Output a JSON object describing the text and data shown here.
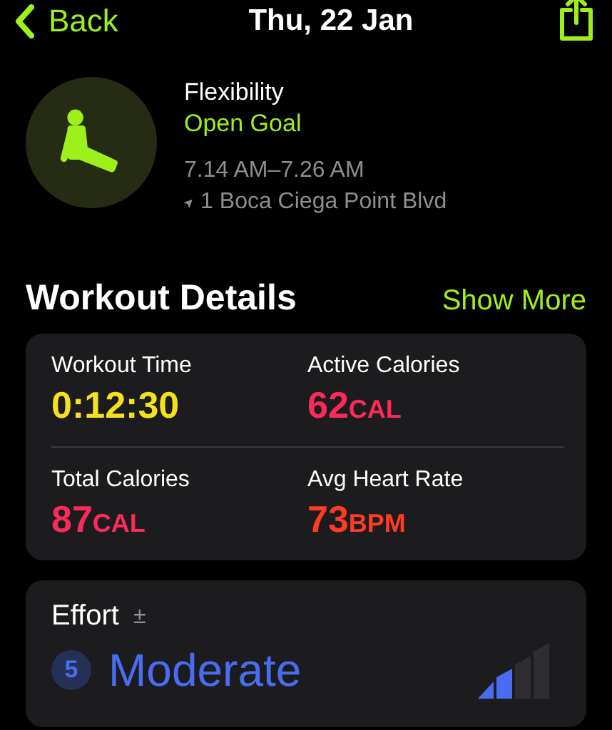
{
  "nav": {
    "back": "Back",
    "title": "Thu, 22 Jan"
  },
  "workout": {
    "name": "Flexibility",
    "goal": "Open Goal",
    "time_range": "7.14 AM–7.26 AM",
    "location_arrow": "➤",
    "location": "1 Boca Ciega Point Blvd"
  },
  "section": {
    "title": "Workout Details",
    "action": "Show More"
  },
  "metrics": [
    {
      "label": "Workout Time",
      "value": "0:12:30",
      "color": "#f4e21c"
    },
    {
      "label": "Active Calories",
      "value": "62",
      "unit": "CAL",
      "color": "#fa2a5a"
    },
    {
      "label": "Total Calories",
      "value": "87",
      "unit": "CAL",
      "color": "#fa2a5a"
    },
    {
      "label": "Avg Heart Rate",
      "value": "73",
      "unit": "BPM",
      "color": "#ff3b22"
    }
  ],
  "effort": {
    "title": "Effort",
    "adjust": "±",
    "score": "5",
    "rating": "Moderate",
    "level": 0.5
  }
}
